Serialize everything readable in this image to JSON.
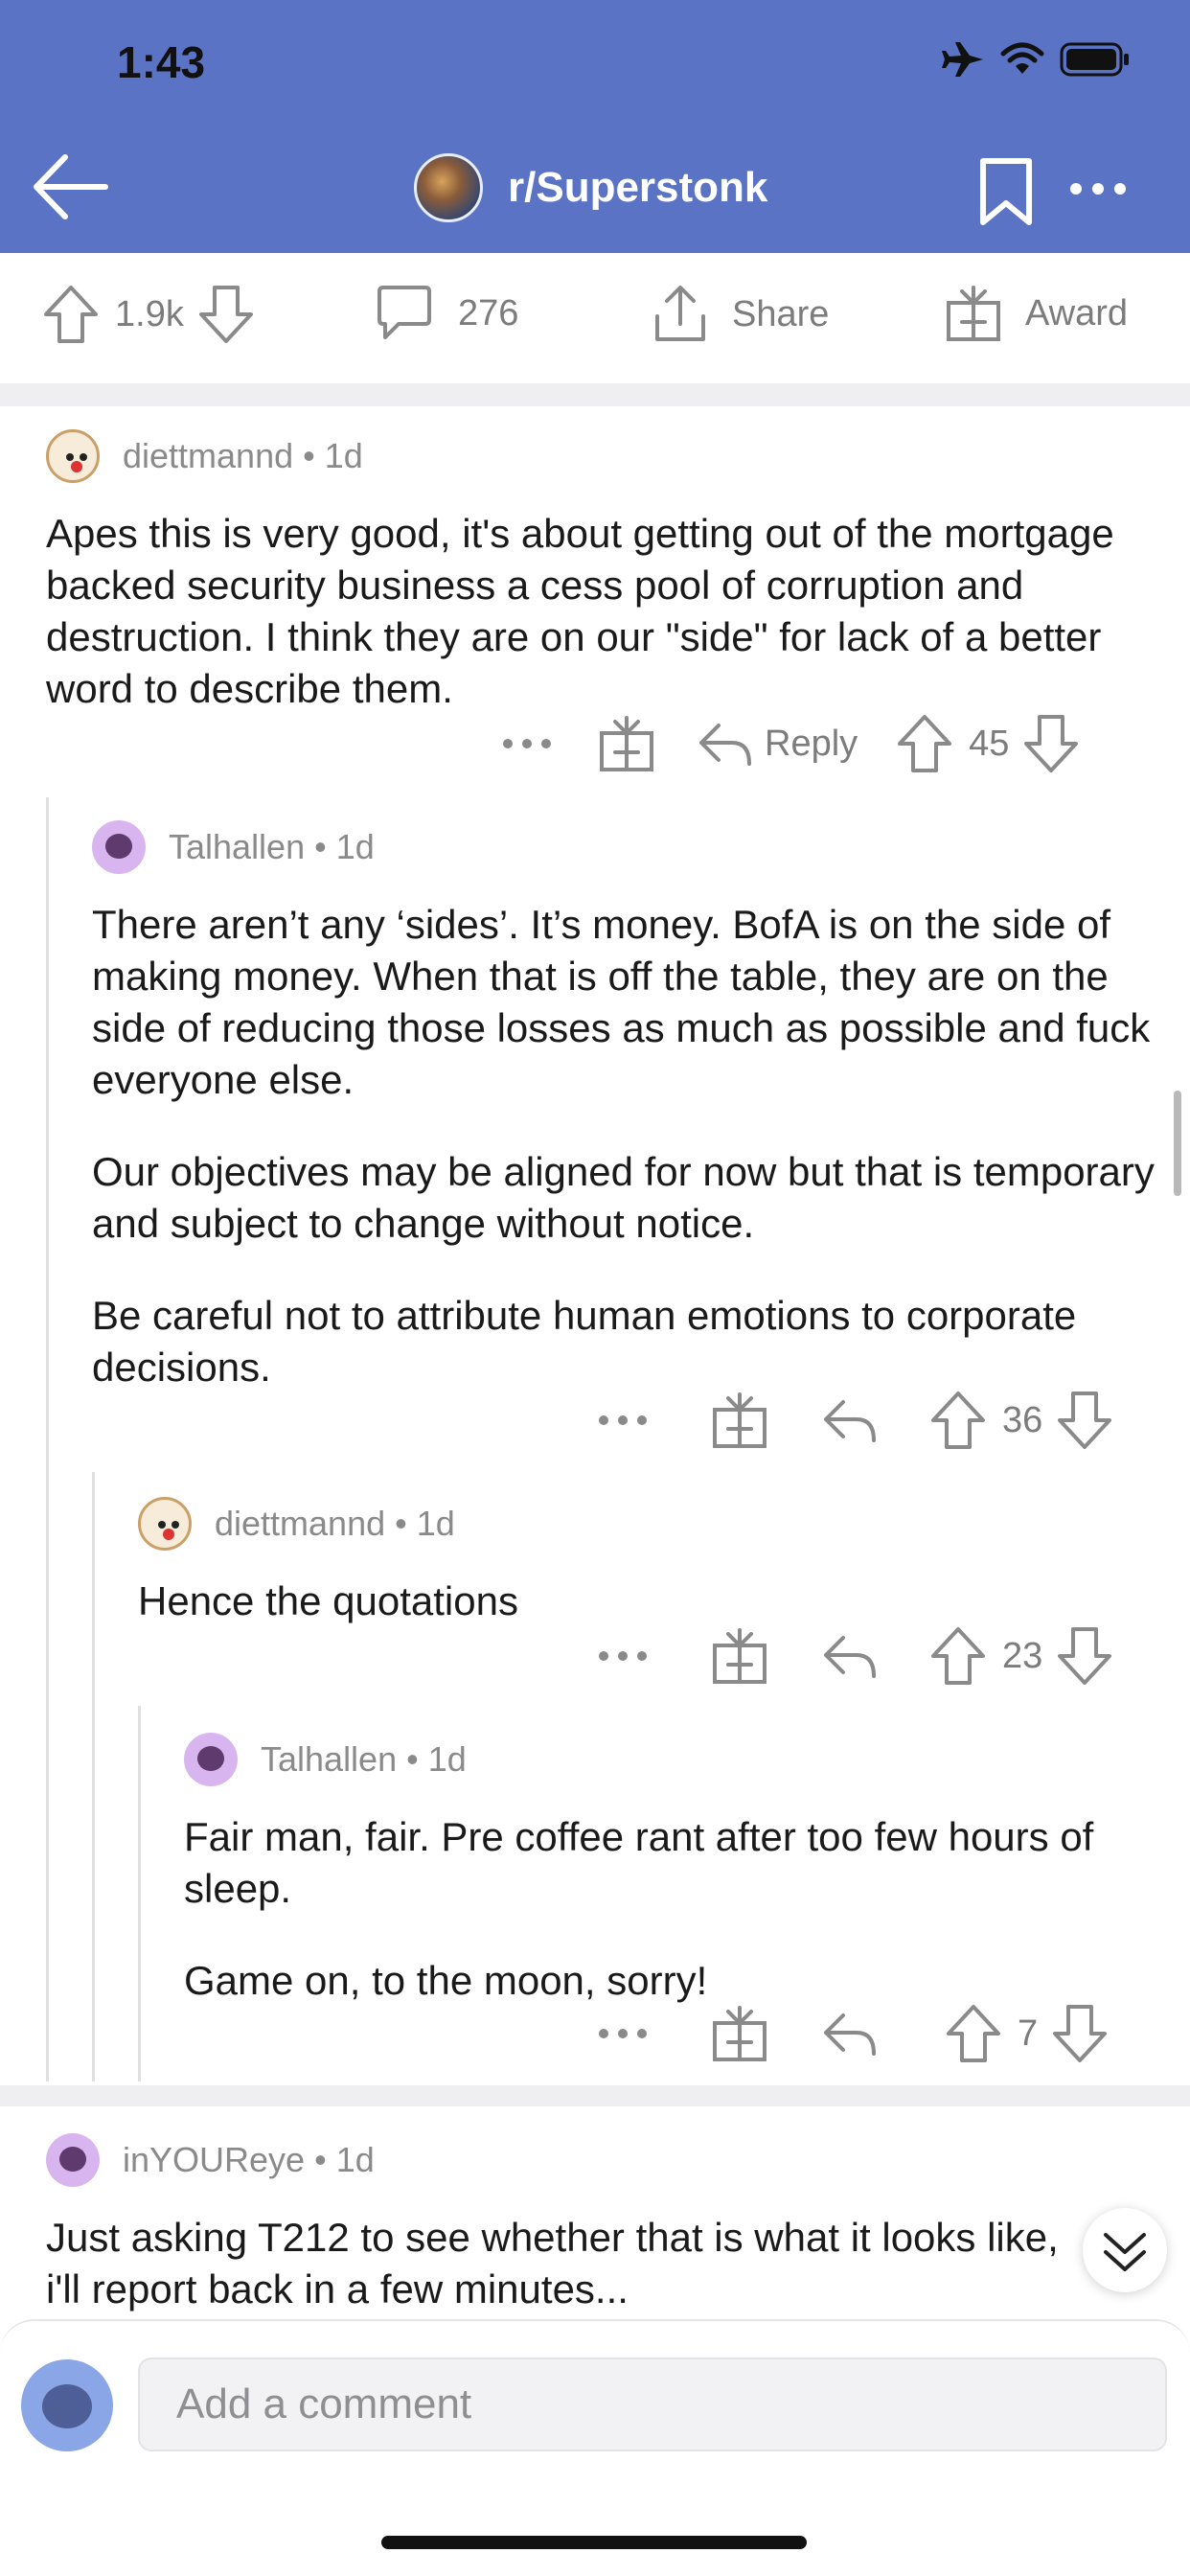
{
  "status_bar": {
    "time": "1:43"
  },
  "header": {
    "subreddit": "r/Superstonk"
  },
  "actions": {
    "upvotes": "1.9k",
    "comments": "276",
    "share": "Share",
    "award": "Award"
  },
  "comments": [
    {
      "author": "diettmannd",
      "age": "1d",
      "body": [
        "Apes this is very good, it's about getting out of the mortgage backed security business a cess pool of corruption and destruction. I think they are on our \"side\" for lack of a better word to describe them."
      ],
      "reply": "Reply",
      "score": "45"
    },
    {
      "author": "Talhallen",
      "age": "1d",
      "body": [
        "There aren’t any ‘sides’. It’s money. BofA is on the side of making money. When that is off the table, they are on the side of reducing those losses as much as possible and fuck everyone else.",
        "Our objectives may be aligned for now but that is temporary and subject to change without notice.",
        "Be careful not to attribute human emotions to corporate decisions."
      ],
      "score": "36"
    },
    {
      "author": "diettmannd",
      "age": "1d",
      "body": [
        "Hence the quotations"
      ],
      "score": "23"
    },
    {
      "author": "Talhallen",
      "age": "1d",
      "body": [
        "Fair man, fair. Pre coffee rant after too few hours of sleep.",
        "Game on, to the moon, sorry!"
      ],
      "score": "7"
    },
    {
      "author": "inYOUReye",
      "age": "1d",
      "body": [
        "Just asking T212 to see whether that is what it looks like, i'll report back in a few minutes..."
      ]
    }
  ],
  "composer": {
    "placeholder": "Add a comment"
  },
  "colors": {
    "header_bg": "#5b73c5",
    "separator": "#efeff1",
    "meta_text": "#8a8a8a"
  },
  "icons": [
    "back-arrow-icon",
    "bookmark-icon",
    "more-icon",
    "upvote-icon",
    "downvote-icon",
    "comment-icon",
    "share-icon",
    "award-icon",
    "reply-icon",
    "airplane-icon",
    "wifi-icon",
    "battery-icon",
    "chevron-double-down-icon"
  ]
}
